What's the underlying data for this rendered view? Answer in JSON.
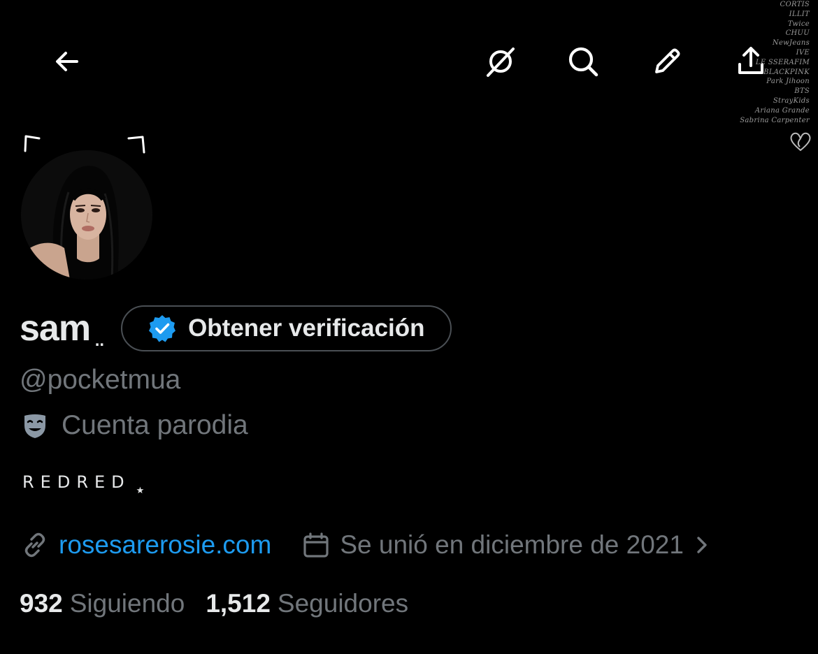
{
  "colors": {
    "background": "#000000",
    "text_primary": "#e7e9ea",
    "text_secondary": "#71767b",
    "link": "#1d9bf0",
    "verified_badge": "#1d9bf0"
  },
  "topbar": {
    "icons": [
      "back-arrow-icon",
      "grok-icon",
      "search-icon",
      "edit-pencil-icon",
      "share-icon"
    ]
  },
  "banner": {
    "lines": [
      "CORTIS",
      "ILLIT",
      "Twice",
      "CHUU",
      "NewJeans",
      "IVE",
      "LE SSERAFIM",
      "BLACKPINK",
      "Park Jihoon",
      "BTS",
      "StrayKids",
      "Ariana Grande",
      "Sabrina Carpenter"
    ]
  },
  "profile": {
    "display_name": "sam",
    "name_suffix": "..",
    "verify_button_label": "Obtener verificación",
    "handle": "@pocketmua",
    "parody_label": "Cuenta parodia",
    "bio": "REDRED",
    "bio_star": "★",
    "website": "rosesarerosie.com",
    "joined": "Se unió en diciembre de 2021"
  },
  "stats": {
    "following_count": "932",
    "following_label": "Siguiendo",
    "followers_count": "1,512",
    "followers_label": "Seguidores"
  }
}
